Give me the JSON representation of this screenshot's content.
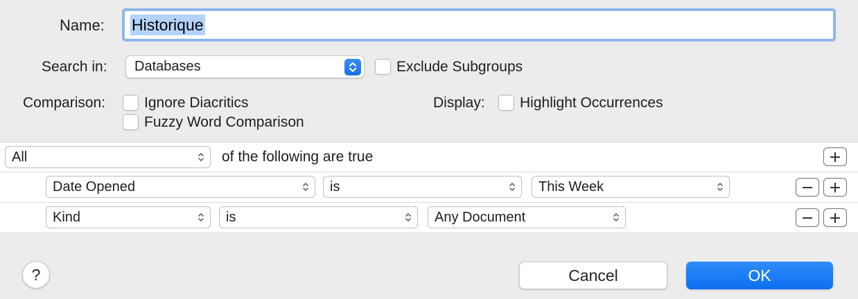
{
  "name": {
    "label": "Name:",
    "value": "Historique"
  },
  "search_in": {
    "label": "Search in:",
    "value": "Databases",
    "exclude_label": "Exclude Subgroups"
  },
  "comparison": {
    "label": "Comparison:",
    "ignore_diacritics": "Ignore Diacritics",
    "fuzzy": "Fuzzy Word Comparison"
  },
  "display": {
    "label": "Display:",
    "highlight": "Highlight Occurrences"
  },
  "criteria": {
    "match": "All",
    "match_suffix": "of the following are true",
    "rows": [
      {
        "field": "Date Opened",
        "operator": "is",
        "value": "This Week"
      },
      {
        "field": "Kind",
        "operator": "is",
        "value": "Any Document"
      }
    ]
  },
  "buttons": {
    "help": "?",
    "cancel": "Cancel",
    "ok": "OK"
  },
  "colors": {
    "accent": "#1a6fe6",
    "focus_ring": "#8fb6ec",
    "selection": "#b3d3fb"
  }
}
